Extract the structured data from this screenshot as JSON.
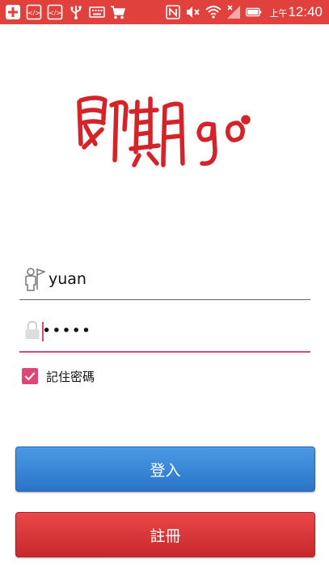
{
  "status_bar": {
    "ampm": "上午",
    "time": "12:40",
    "background": "#e0413d",
    "left_icons": [
      "plus-icon",
      "code-icon",
      "code-icon",
      "usb-icon",
      "keyboard-icon",
      "cart-icon"
    ],
    "right_icons": [
      "nfc-icon",
      "mute-icon",
      "wifi-icon",
      "signal-icon",
      "battery-icon"
    ]
  },
  "logo": {
    "text": "即期go",
    "color": "#d4242a"
  },
  "login_form": {
    "username_value": "yuan",
    "password_value": "•••••",
    "remember_label": "記住密碼",
    "remember_checked": true,
    "accent": "#e0457a"
  },
  "buttons": {
    "login_label": "登入",
    "register_label": "註冊",
    "login_color": "#3a86d8",
    "register_color": "#d8353a"
  }
}
